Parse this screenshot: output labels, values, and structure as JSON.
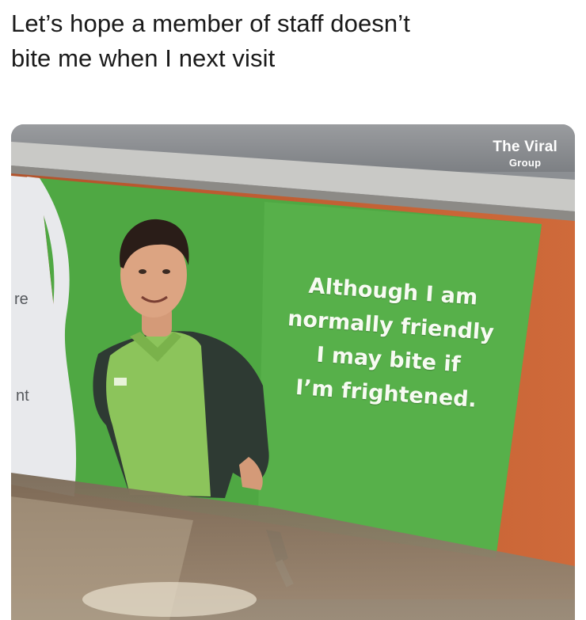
{
  "post": {
    "caption_line1": "Let’s hope a member of staff doesn’t",
    "caption_line2": "bite me when I next visit"
  },
  "photo": {
    "watermark_line1": "The Viral",
    "watermark_line2": "Group",
    "poster_lines": [
      "Although I am",
      "normally friendly",
      "I may bite if",
      "I’m frightened."
    ],
    "edge_fragment_1": "re",
    "edge_fragment_2": "nt",
    "colors": {
      "poster_green": "#4fa843",
      "poster_dark_green": "#3b9a3c",
      "shirt_green": "#8cc45b",
      "wood": "#c45f34"
    }
  }
}
